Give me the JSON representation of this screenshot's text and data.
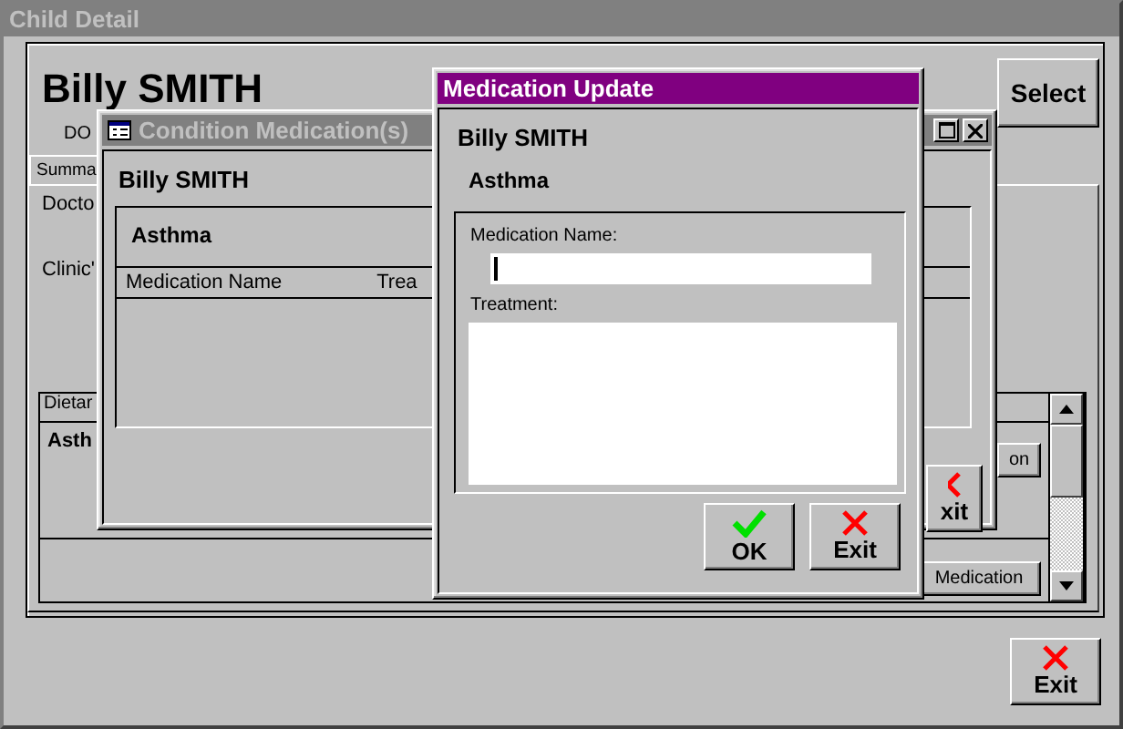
{
  "main_window": {
    "title": "Child Detail",
    "name": "Billy SMITH",
    "dob_label": "DO",
    "select_button": "Select",
    "tabs": [
      {
        "label": "Summa",
        "selected": true
      }
    ],
    "fields": [
      "Docto",
      "Clinic'"
    ],
    "dietary_panel": {
      "header": "Dietar",
      "condition": "Asth",
      "side_button": "on",
      "medication_button": "Medication"
    },
    "exit_button": "Exit"
  },
  "condition_window": {
    "title": "Condition Medication(s)",
    "active": false,
    "name": "Billy SMITH",
    "condition": "Asthma",
    "columns": [
      "Medication Name",
      "Trea"
    ],
    "exit_button": "xit"
  },
  "medication_window": {
    "title": "Medication Update",
    "active": true,
    "name": "Billy SMITH",
    "condition": "Asthma",
    "medication_name_label": "Medication Name:",
    "treatment_label": "Treatment:",
    "ok_button": "OK",
    "exit_button": "Exit"
  }
}
